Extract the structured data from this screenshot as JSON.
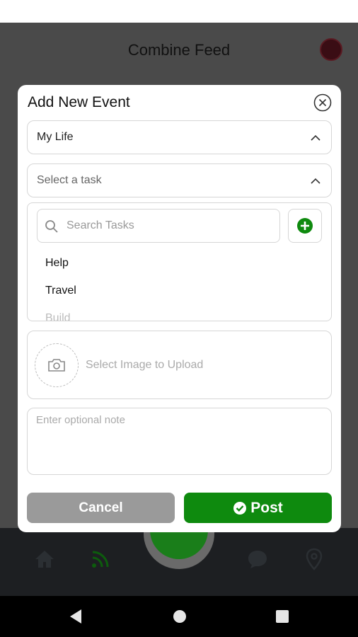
{
  "header": {
    "title": "Combine Feed"
  },
  "modal": {
    "title": "Add New Event",
    "category_value": "My Life",
    "task_placeholder": "Select a task",
    "search_placeholder": "Search Tasks",
    "tasks": [
      "Help",
      "Travel",
      "Build"
    ],
    "upload_label": "Select Image to Upload",
    "note_placeholder": "Enter optional note",
    "cancel_label": "Cancel",
    "post_label": "Post"
  },
  "icons": {
    "close": "close-circle-icon",
    "chevron": "chevron-up-icon",
    "search": "search-icon",
    "add": "plus-circle-icon",
    "camera": "camera-icon",
    "post": "check-circle-icon",
    "nav": [
      "home-icon",
      "feed-icon",
      "add-icon",
      "chat-icon",
      "map-pin-icon"
    ],
    "system": [
      "back-icon",
      "home-circle-icon",
      "recent-apps-icon"
    ]
  },
  "colors": {
    "accent": "#0e8a0e",
    "cancel": "#9a9a9a",
    "overlay": "#4a4a4a",
    "nav_bg": "#1d1f22"
  }
}
